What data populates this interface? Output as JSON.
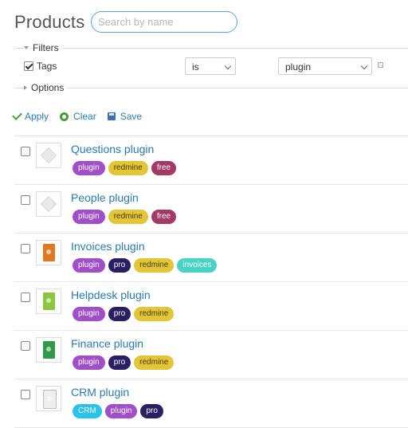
{
  "header": {
    "title": "Products"
  },
  "search": {
    "placeholder": "Search by name"
  },
  "filters": {
    "legend": "Filters",
    "row": {
      "label": "Tags",
      "operator": "is",
      "value": "plugin",
      "checked": true
    }
  },
  "options": {
    "legend": "Options"
  },
  "actions": {
    "apply": "Apply",
    "clear": "Clear",
    "save": "Save"
  },
  "tag_colors": {
    "plugin": {
      "bg": "#a04fc8",
      "fg": "#ffffff"
    },
    "redmine": {
      "bg": "#e2c638",
      "fg": "#4a3b00"
    },
    "free": {
      "bg": "#a33a66",
      "fg": "#ffffff"
    },
    "pro": {
      "bg": "#2a1f63",
      "fg": "#ffffff"
    },
    "invoices": {
      "bg": "#49d3c4",
      "fg": "#ffffff"
    },
    "CRM": {
      "bg": "#29c4ec",
      "fg": "#ffffff"
    }
  },
  "products": [
    {
      "name": "Questions plugin",
      "icon": "box-icon",
      "tags": [
        "plugin",
        "redmine",
        "free"
      ]
    },
    {
      "name": "People plugin",
      "icon": "box-icon",
      "tags": [
        "plugin",
        "redmine",
        "free"
      ]
    },
    {
      "name": "Invoices plugin",
      "icon": "orange-book-icon",
      "book_color": "#e07a22",
      "tags": [
        "plugin",
        "pro",
        "redmine",
        "invoices"
      ]
    },
    {
      "name": "Helpdesk plugin",
      "icon": "green-book-icon",
      "book_color": "#8cc63f",
      "tags": [
        "plugin",
        "pro",
        "redmine"
      ]
    },
    {
      "name": "Finance plugin",
      "icon": "darkgreen-book-icon",
      "book_color": "#2e9a4a",
      "tags": [
        "plugin",
        "pro",
        "redmine"
      ]
    },
    {
      "name": "CRM plugin",
      "icon": "white-book-icon",
      "book_color": "#eeeeee",
      "tags": [
        "CRM",
        "plugin",
        "pro"
      ]
    }
  ]
}
